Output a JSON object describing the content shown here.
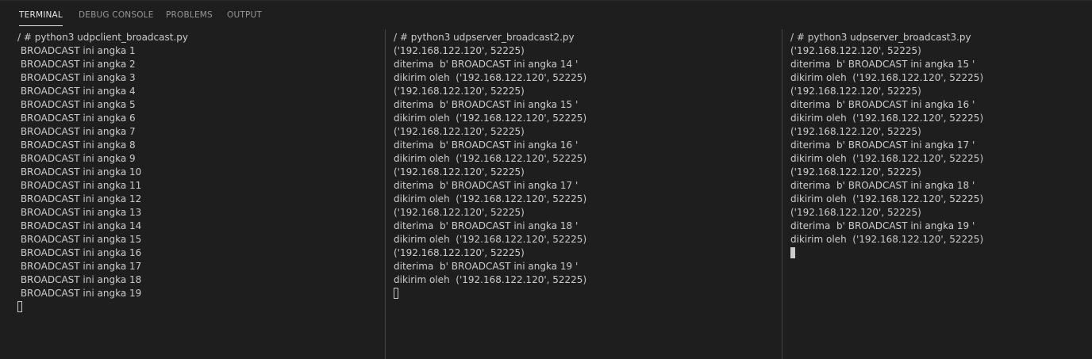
{
  "tabs": [
    {
      "label": "TERMINAL",
      "active": true
    },
    {
      "label": "DEBUG CONSOLE",
      "active": false
    },
    {
      "label": "PROBLEMS",
      "active": false
    },
    {
      "label": "OUTPUT",
      "active": false
    }
  ],
  "terminals": [
    {
      "lines": [
        "/ # python3 udpclient_broadcast.py",
        " BROADCAST ini angka 1",
        " BROADCAST ini angka 2",
        " BROADCAST ini angka 3",
        " BROADCAST ini angka 4",
        " BROADCAST ini angka 5",
        " BROADCAST ini angka 6",
        " BROADCAST ini angka 7",
        " BROADCAST ini angka 8",
        " BROADCAST ini angka 9",
        " BROADCAST ini angka 10",
        " BROADCAST ini angka 11",
        " BROADCAST ini angka 12",
        " BROADCAST ini angka 13",
        " BROADCAST ini angka 14",
        " BROADCAST ini angka 15",
        " BROADCAST ini angka 16",
        " BROADCAST ini angka 17",
        " BROADCAST ini angka 18",
        " BROADCAST ini angka 19"
      ],
      "cursor": "hollow"
    },
    {
      "lines": [
        "/ # python3 udpserver_broadcast2.py",
        "('192.168.122.120', 52225)",
        "diterima  b' BROADCAST ini angka 14 '",
        "dikirim oleh  ('192.168.122.120', 52225)",
        "('192.168.122.120', 52225)",
        "diterima  b' BROADCAST ini angka 15 '",
        "dikirim oleh  ('192.168.122.120', 52225)",
        "('192.168.122.120', 52225)",
        "diterima  b' BROADCAST ini angka 16 '",
        "dikirim oleh  ('192.168.122.120', 52225)",
        "('192.168.122.120', 52225)",
        "diterima  b' BROADCAST ini angka 17 '",
        "dikirim oleh  ('192.168.122.120', 52225)",
        "('192.168.122.120', 52225)",
        "diterima  b' BROADCAST ini angka 18 '",
        "dikirim oleh  ('192.168.122.120', 52225)",
        "('192.168.122.120', 52225)",
        "diterima  b' BROADCAST ini angka 19 '",
        "dikirim oleh  ('192.168.122.120', 52225)"
      ],
      "cursor": "hollow"
    },
    {
      "lines": [
        "/ # python3 udpserver_broadcast3.py",
        "('192.168.122.120', 52225)",
        "diterima  b' BROADCAST ini angka 15 '",
        "dikirim oleh  ('192.168.122.120', 52225)",
        "('192.168.122.120', 52225)",
        "diterima  b' BROADCAST ini angka 16 '",
        "dikirim oleh  ('192.168.122.120', 52225)",
        "('192.168.122.120', 52225)",
        "diterima  b' BROADCAST ini angka 17 '",
        "dikirim oleh  ('192.168.122.120', 52225)",
        "('192.168.122.120', 52225)",
        "diterima  b' BROADCAST ini angka 18 '",
        "dikirim oleh  ('192.168.122.120', 52225)",
        "('192.168.122.120', 52225)",
        "diterima  b' BROADCAST ini angka 19 '",
        "dikirim oleh  ('192.168.122.120', 52225)"
      ],
      "cursor": "solid"
    }
  ],
  "colors": {
    "background": "#1e1e1e",
    "text": "#cccccc",
    "tab_active": "#e7e7e7",
    "tab_inactive": "#969696",
    "divider": "#444444"
  }
}
